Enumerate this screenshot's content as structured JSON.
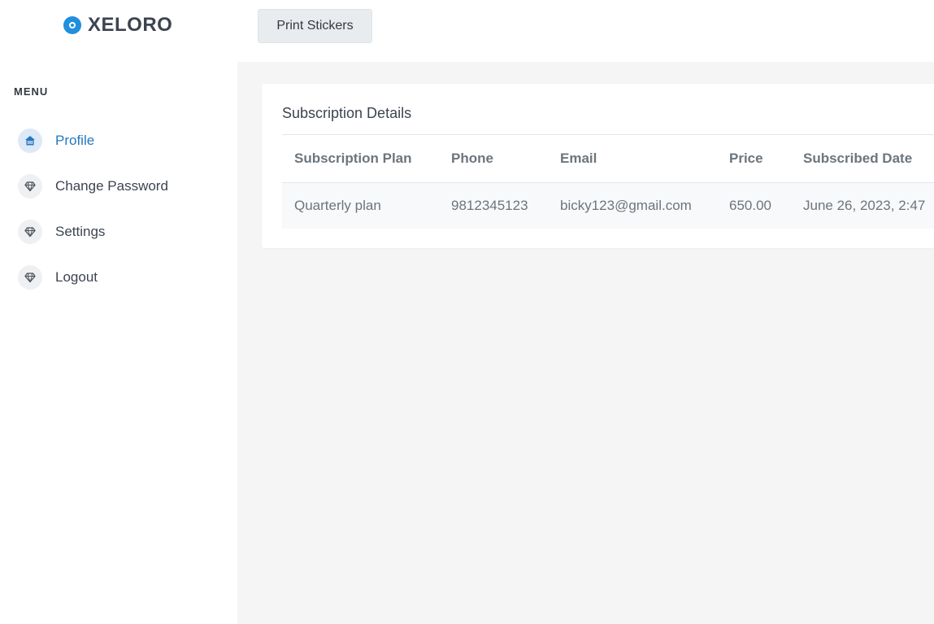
{
  "brand": {
    "name": "XELORO",
    "icon": "logo-target-icon",
    "accent": "#1f8fde"
  },
  "sidebar": {
    "menu_title": "MENU",
    "items": [
      {
        "label": "Profile",
        "icon": "home-icon",
        "active": true
      },
      {
        "label": "Change Password",
        "icon": "diamond-icon",
        "active": false
      },
      {
        "label": "Settings",
        "icon": "diamond-icon",
        "active": false
      },
      {
        "label": "Logout",
        "icon": "diamond-icon",
        "active": false
      }
    ]
  },
  "toolbar": {
    "print_label": "Print Stickers"
  },
  "card": {
    "title": "Subscription Details",
    "columns": [
      "Subscription Plan",
      "Phone",
      "Email",
      "Price",
      "Subscribed Date"
    ],
    "rows": [
      [
        "Quarterly plan",
        "9812345123",
        "bicky123@gmail.com",
        "650.00",
        "June 26, 2023, 2:47"
      ]
    ]
  },
  "colors": {
    "active_link": "#2479c0",
    "page_bg": "#f5f5f6"
  }
}
